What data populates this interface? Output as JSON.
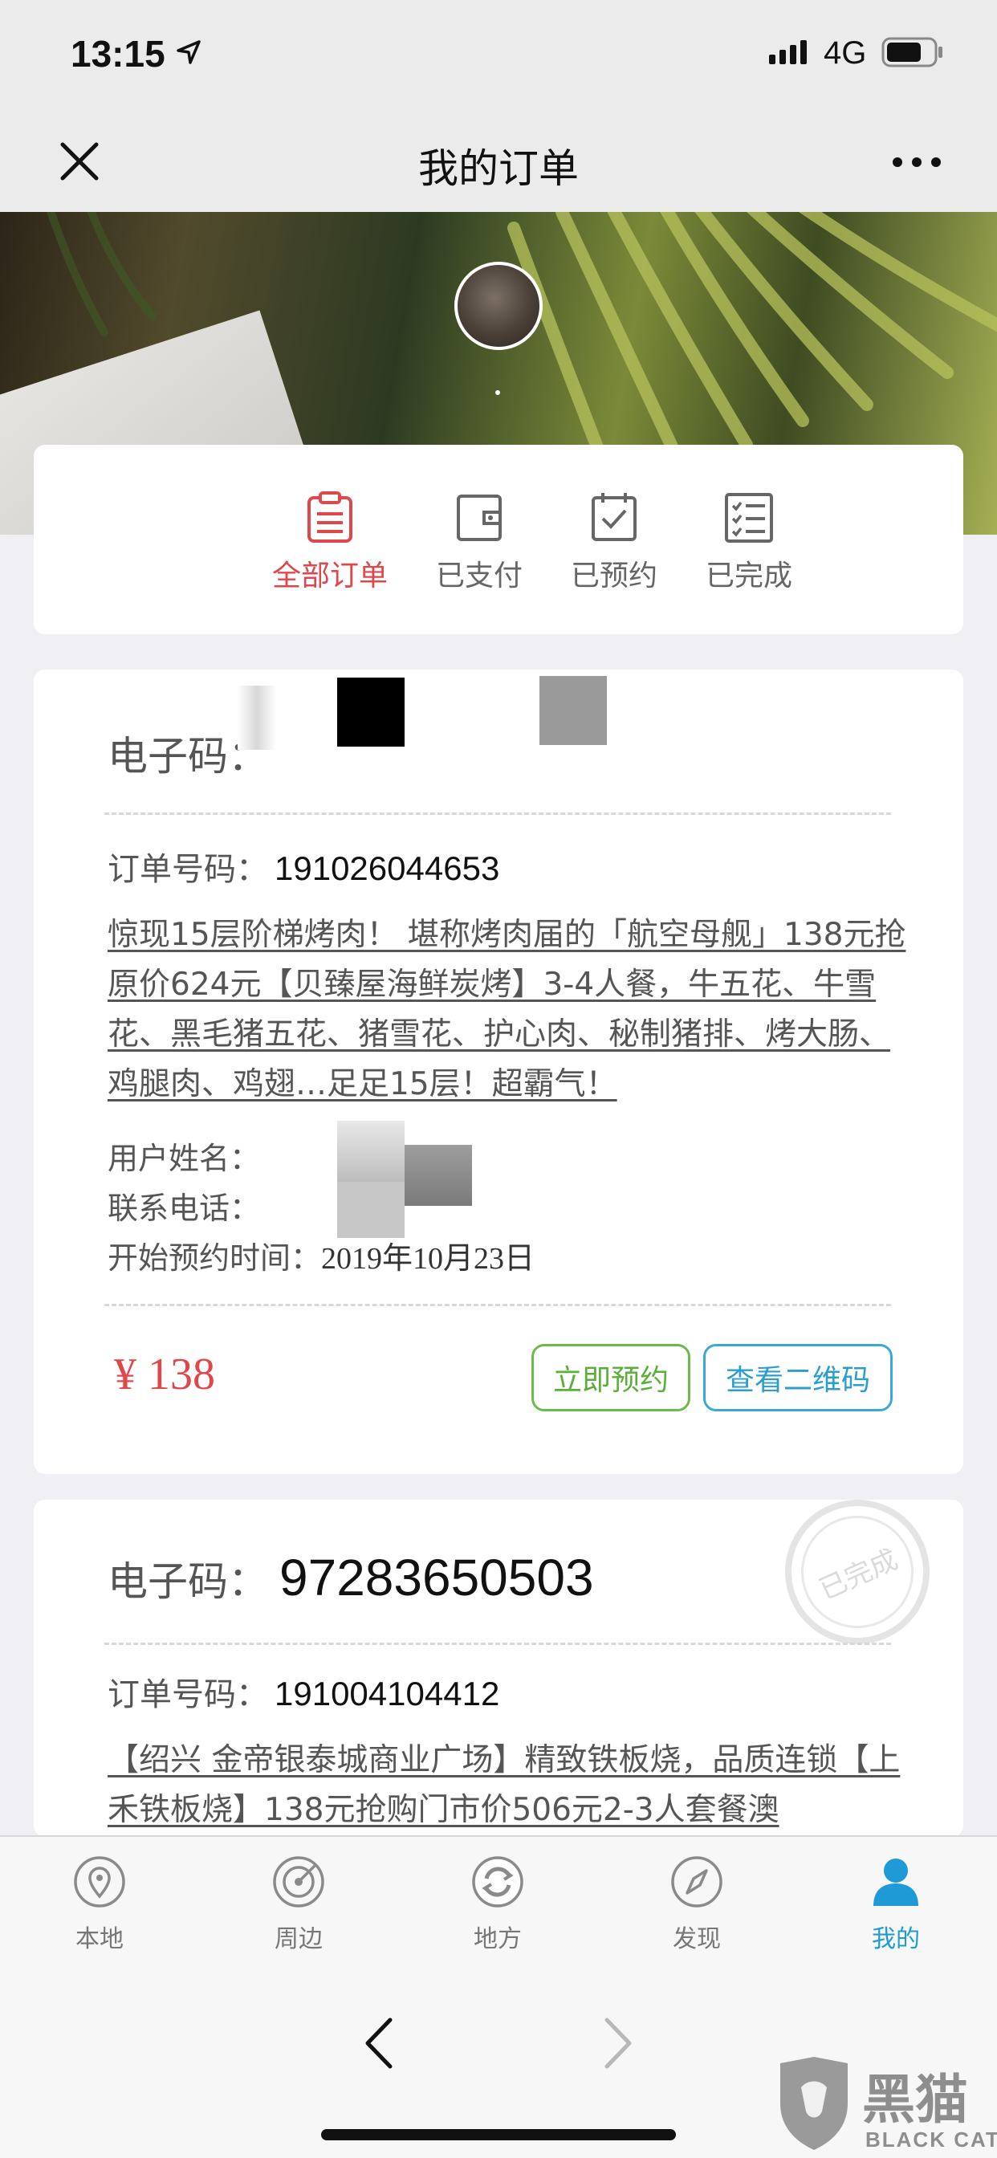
{
  "status_bar": {
    "time": "13:15",
    "network": "4G",
    "icons": [
      "location-arrow-icon",
      "signal-icon",
      "battery-icon"
    ]
  },
  "nav": {
    "title": "我的订单",
    "icons": [
      "close-icon",
      "more-icon"
    ]
  },
  "banner": {
    "avatar_icon": "avatar"
  },
  "tabs": [
    {
      "label": "全部订单",
      "icon": "clipboard-list-icon",
      "active": true
    },
    {
      "label": "已支付",
      "icon": "wallet-icon",
      "active": false
    },
    {
      "label": "已预约",
      "icon": "calendar-check-icon",
      "active": false
    },
    {
      "label": "已完成",
      "icon": "checklist-icon",
      "active": false
    }
  ],
  "orders": [
    {
      "code_label": "电子码：",
      "code_value": "",
      "order_no_label": "订单号码：",
      "order_no": "191026044653",
      "title": "惊现15层阶梯烤肉！ 堪称烤肉届的「航空母舰」138元抢原价624元【贝臻屋海鲜炭烤】3-4人餐，牛五花、牛雪花、黑毛猪五花、猪雪花、护心肉、秘制猪排、烤大肠、鸡腿肉、鸡翅…足足15层！超霸气！",
      "user_name_label": "用户姓名：",
      "phone_label": "联系电话：",
      "start_time_label": "开始预约时间：",
      "start_time": "2019年10月23日",
      "price": "¥ 138",
      "reserve_button": "立即预约",
      "qrcode_button": "查看二维码"
    },
    {
      "code_label": "电子码：",
      "code_value": "97283650503",
      "order_no_label": "订单号码：",
      "order_no": "191004104412",
      "title": "【绍兴 金帝银泰城商业广场】精致铁板烧，品质连锁【上禾铁板烧】138元抢购门市价506元2-3人套餐澳",
      "stamp_text": "已完成"
    }
  ],
  "bottom_tabs": [
    {
      "label": "本地",
      "icon": "location-pin-icon",
      "active": false
    },
    {
      "label": "周边",
      "icon": "radar-icon",
      "active": false
    },
    {
      "label": "地方",
      "icon": "refresh-circle-icon",
      "active": false
    },
    {
      "label": "发现",
      "icon": "compass-icon",
      "active": false
    },
    {
      "label": "我的",
      "icon": "user-icon",
      "active": true
    }
  ],
  "browser": {
    "icons": [
      "back-arrow-icon",
      "forward-arrow-icon"
    ]
  },
  "watermark": {
    "cn": "黑猫",
    "en": "BLACK CAT"
  },
  "colors": {
    "accent_red": "#e0474b",
    "accent_blue": "#1e9bd7",
    "button_green": "#6cbb4a",
    "button_blue": "#3aa9d6",
    "background": "#efeff4"
  }
}
